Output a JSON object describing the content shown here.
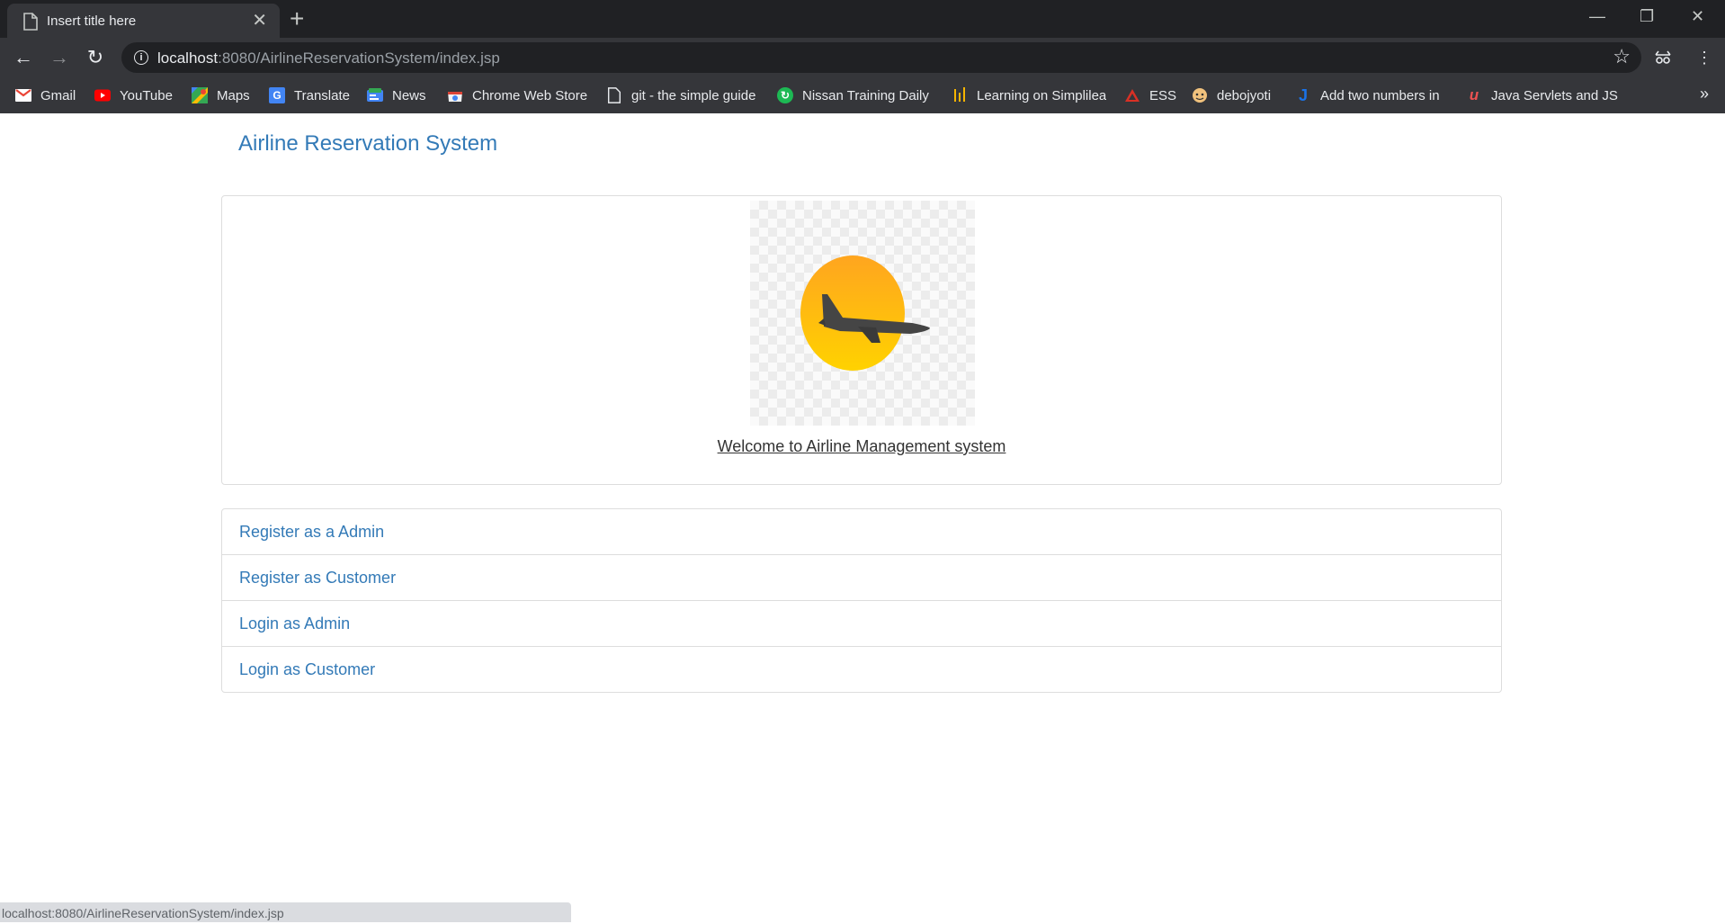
{
  "browser": {
    "tab_title": "Insert title here",
    "tab_close": "✕",
    "new_tab": "+",
    "url_host": "localhost",
    "url_path": ":8080/AirlineReservationSystem/index.jsp",
    "window_controls": {
      "minimize": "—",
      "restore": "❐",
      "close": "✕"
    },
    "nav": {
      "back": "←",
      "forward": "→",
      "reload": "↻"
    },
    "bookmarks": [
      {
        "label": "Gmail",
        "icon": "gmail-icon",
        "color": "#ea4335"
      },
      {
        "label": "YouTube",
        "icon": "youtube-icon",
        "color": "#ff0000"
      },
      {
        "label": "Maps",
        "icon": "maps-icon",
        "color": "#34a853"
      },
      {
        "label": "Translate",
        "icon": "translate-icon",
        "color": "#4285f4"
      },
      {
        "label": "News",
        "icon": "news-icon",
        "color": "#4285f4"
      },
      {
        "label": "Chrome Web Store",
        "icon": "web-store-icon",
        "color": "#db4437"
      },
      {
        "label": "git - the simple guide",
        "icon": "page-icon",
        "color": "#e8eaed"
      },
      {
        "label": "Nissan Training Daily",
        "icon": "nissan-icon",
        "color": "#1db954"
      },
      {
        "label": "Learning on Simplilearn",
        "icon": "simplilearn-icon",
        "color": "#f5b400"
      },
      {
        "label": "ESS",
        "icon": "ess-icon",
        "color": "#d93025"
      },
      {
        "label": "debojyoti",
        "icon": "avatar-icon",
        "color": "#f1c27d"
      },
      {
        "label": "Add two numbers in",
        "icon": "j-icon",
        "color": "#1a73e8"
      },
      {
        "label": "Java Servlets and JSP",
        "icon": "udemy-icon",
        "color": "#ec5252"
      }
    ],
    "bookmarks_more": "»",
    "status_url": "localhost:8080/AirlineReservationSystem/index.jsp"
  },
  "page": {
    "brand": "Airline Reservation System",
    "welcome": "Welcome to Airline Management system",
    "links": [
      "Register as a Admin",
      "Register as Customer",
      "Login as Admin",
      "Login as Customer"
    ]
  },
  "colors": {
    "link": "#337ab7",
    "sun_top": "#ffa51f",
    "sun_bottom": "#ffd200",
    "plane": "#454545"
  }
}
